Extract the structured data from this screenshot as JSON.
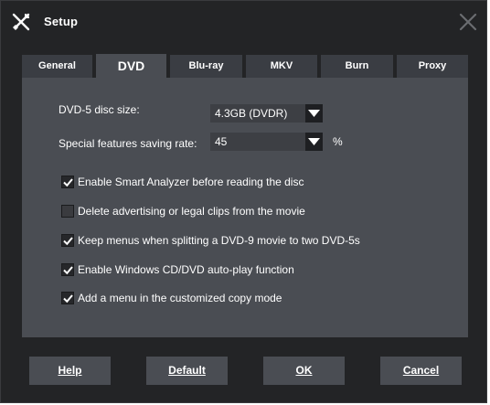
{
  "window": {
    "title": "Setup"
  },
  "tabs": [
    {
      "label": "General"
    },
    {
      "label": "DVD"
    },
    {
      "label": "Blu-ray"
    },
    {
      "label": "MKV"
    },
    {
      "label": "Burn"
    },
    {
      "label": "Proxy"
    }
  ],
  "dvd": {
    "disc_size_label": "DVD-5 disc size:",
    "disc_size_value": "4.3GB (DVDR)",
    "saving_rate_label": "Special features saving rate:",
    "saving_rate_value": "45",
    "saving_rate_unit": "%",
    "options": [
      {
        "label": "Enable Smart Analyzer before reading the disc",
        "checked": true
      },
      {
        "label": "Delete advertising or legal clips from the movie",
        "checked": false
      },
      {
        "label": "Keep menus when splitting a DVD-9 movie to two DVD-5s",
        "checked": true
      },
      {
        "label": "Enable Windows CD/DVD auto-play function",
        "checked": true
      },
      {
        "label": "Add a menu in the customized copy mode",
        "checked": true
      }
    ]
  },
  "buttons": {
    "help": "Help",
    "default": "Default",
    "ok": "OK",
    "cancel": "Cancel"
  },
  "icons": {
    "title": "tools-icon",
    "close": "close-icon",
    "dropdown": "chevron-down-icon",
    "check": "checkmark-icon"
  }
}
